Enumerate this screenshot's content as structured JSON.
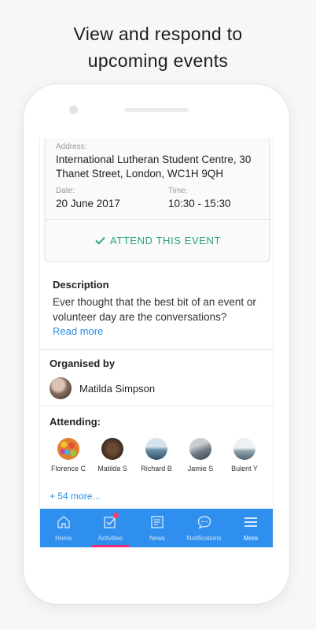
{
  "headline": {
    "line1": "View and respond to",
    "line2": "upcoming events"
  },
  "event": {
    "address_label": "Address:",
    "address_value": "International Lutheran Student Centre, 30 Thanet Street, London, WC1H 9QH",
    "date_label": "Date:",
    "date_value": "20 June 2017",
    "time_label": "Time:",
    "time_value": "10:30 - 15:30",
    "attend_label": "ATTEND THIS EVENT",
    "attend_icon": "check-icon",
    "accent_color": "#2aa37a"
  },
  "description": {
    "title": "Description",
    "text": "Ever thought that the best bit of an event or volunteer day are the conversations?",
    "read_more": "Read more"
  },
  "organiser": {
    "title": "Organised by",
    "name": "Matilda Simpson"
  },
  "attending": {
    "title": "Attending:",
    "people": [
      {
        "name": "Florence C"
      },
      {
        "name": "Matilda S"
      },
      {
        "name": "Richard B"
      },
      {
        "name": "Jamie S"
      },
      {
        "name": "Bulent Y"
      }
    ],
    "more": "+ 54 more..."
  },
  "tabbar": {
    "color": "#2f8fee",
    "selected_underline_color": "#ec2a7b",
    "tabs": [
      {
        "label": "Home",
        "icon": "home-icon"
      },
      {
        "label": "Activities",
        "icon": "checkbox-icon"
      },
      {
        "label": "News",
        "icon": "newspaper-icon"
      },
      {
        "label": "Notifications",
        "icon": "chat-bubble-icon"
      },
      {
        "label": "More",
        "icon": "hamburger-menu-icon"
      }
    ]
  }
}
